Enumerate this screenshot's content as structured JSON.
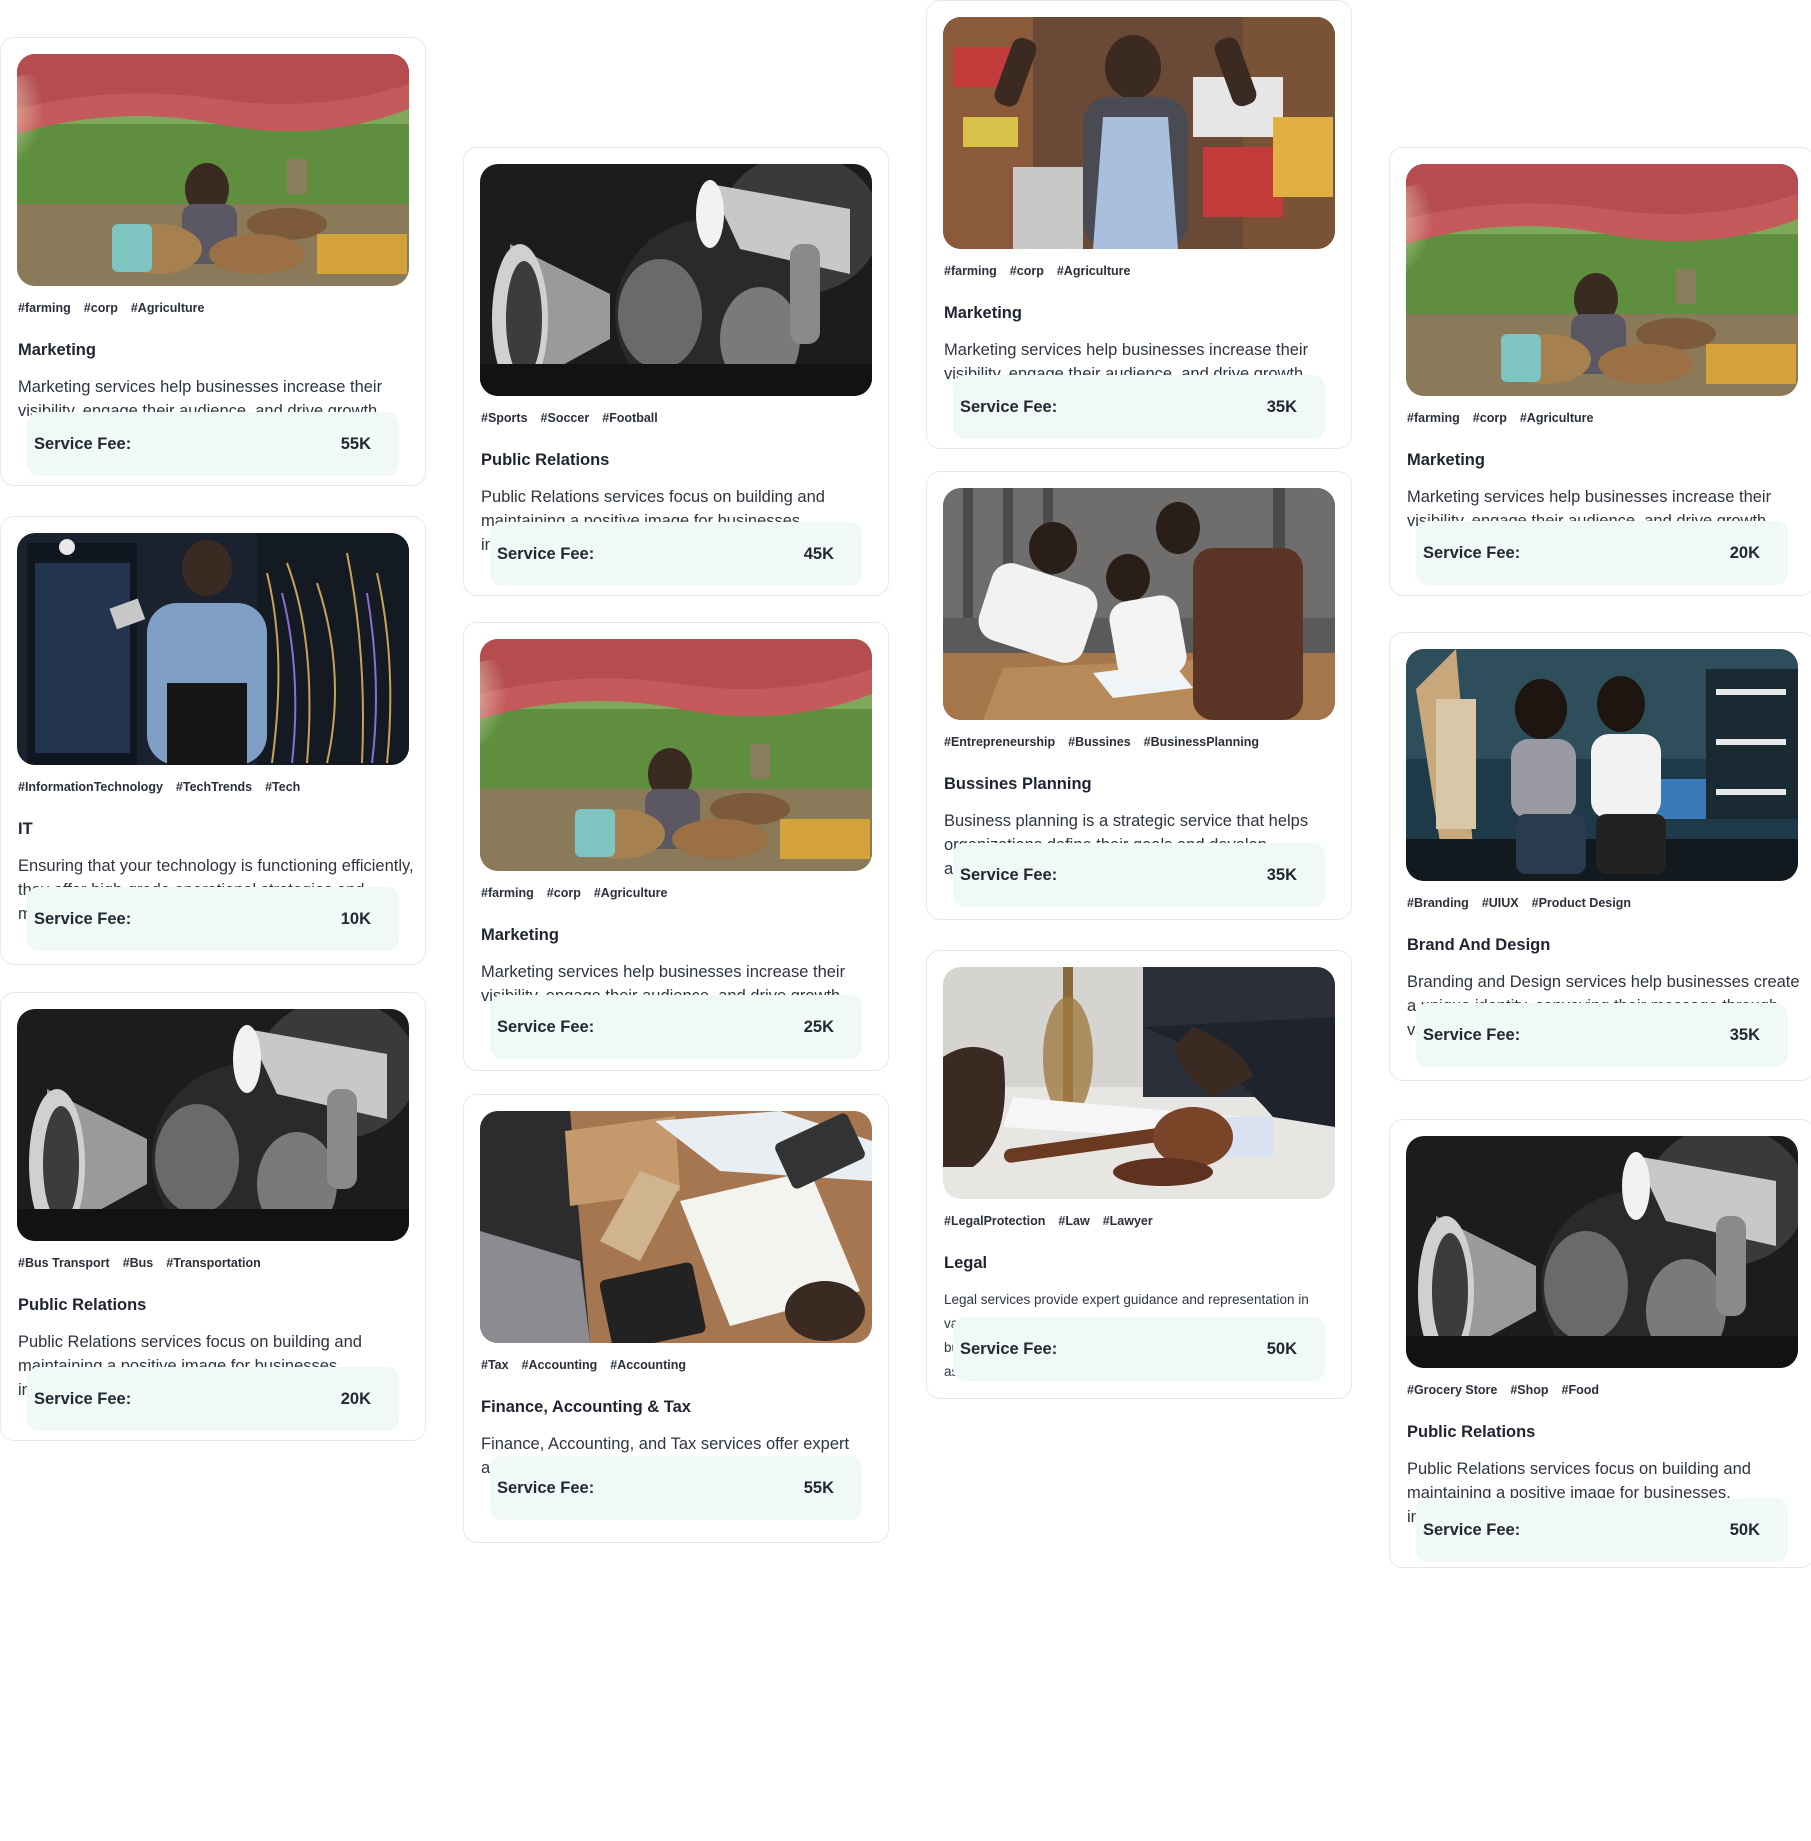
{
  "fee_label": "Service Fee:",
  "cards": [
    {
      "tags": [
        "#farming",
        "#corp",
        "#Agriculture"
      ],
      "title": "Marketing",
      "desc": "Marketing services help businesses increase their visibility, engage their audience, and drive growth.",
      "fee": "55K",
      "image": "market-vendor-photo"
    },
    {
      "tags": [
        "#InformationTechnology",
        "#TechTrends",
        "#Tech"
      ],
      "title": "IT",
      "desc": "Ensuring that your technology is functioning efficiently, they offer high-grade operational strategies and maintain the security of your work devices.",
      "fee": "10K",
      "image": "server-room-technician-photo"
    },
    {
      "tags": [
        "#Bus Transport",
        "#Bus",
        "#Transportation"
      ],
      "title": "Public Relations",
      "desc": "Public Relations services focus on building and maintaining a positive image for businesses, individuals, or organizations.",
      "fee": "20K",
      "image": "megaphone-protest-photo"
    },
    {
      "tags": [
        "#Sports",
        "#Soccer",
        "#Football"
      ],
      "title": "Public Relations",
      "desc": "Public Relations services focus on building and maintaining a positive image for businesses, individuals, or organizations.",
      "fee": "45K",
      "image": "megaphone-protest-photo"
    },
    {
      "tags": [
        "#farming",
        "#corp",
        "#Agriculture"
      ],
      "title": "Marketing",
      "desc": "Marketing services help businesses increase their visibility, engage their audience, and drive growth.",
      "fee": "25K",
      "image": "market-vendor-photo"
    },
    {
      "tags": [
        "#Tax",
        "#Accounting",
        "#Accounting"
      ],
      "title": "Finance, Accounting & Tax",
      "desc": "Finance, Accounting, and Tax services offer expert assistance in managing your financial health.",
      "fee": "55K",
      "image": "desk-calculator-photo"
    },
    {
      "tags": [
        "#farming",
        "#corp",
        "#Agriculture"
      ],
      "title": "Marketing",
      "desc": "Marketing services help businesses increase their visibility, engage their audience, and drive growth.",
      "fee": "35K",
      "image": "shop-woman-cheering-photo"
    },
    {
      "tags": [
        "#Entrepreneurship",
        "#Bussines",
        "#BusinessPlanning"
      ],
      "title": "Bussines Planning",
      "desc": "Business planning is a strategic service that helps organizations define their goals and develop actionable steps to achieve them.",
      "fee": "35K",
      "image": "team-meeting-photo"
    },
    {
      "tags": [
        "#LegalProtection",
        "#Law",
        "#Lawyer"
      ],
      "title": "Legal",
      "desc": "Legal services provide expert guidance and representation in various areas of law. Whether you're navigating personal or business legal matters, I offer reliable and professional legal assistance.",
      "fee": "50K",
      "image": "gavel-signing-photo"
    },
    {
      "tags": [
        "#farming",
        "#corp",
        "#Agriculture"
      ],
      "title": "Marketing",
      "desc": "Marketing services help businesses increase their visibility, engage their audience, and drive growth.",
      "fee": "20K",
      "image": "market-vendor-photo"
    },
    {
      "tags": [
        "#Branding",
        "#UIUX",
        "#Product Design"
      ],
      "title": "Brand And Design",
      "desc": "Branding and Design services help businesses create a unique identity, conveying their message through visual elements.",
      "fee": "35K",
      "image": "art-studio-photo"
    },
    {
      "tags": [
        "#Grocery Store",
        "#Shop",
        "#Food"
      ],
      "title": "Public Relations",
      "desc": "Public Relations services focus on building and maintaining a positive image for businesses, individuals, or organizations.",
      "fee": "50K",
      "image": "megaphone-protest-photo"
    }
  ]
}
